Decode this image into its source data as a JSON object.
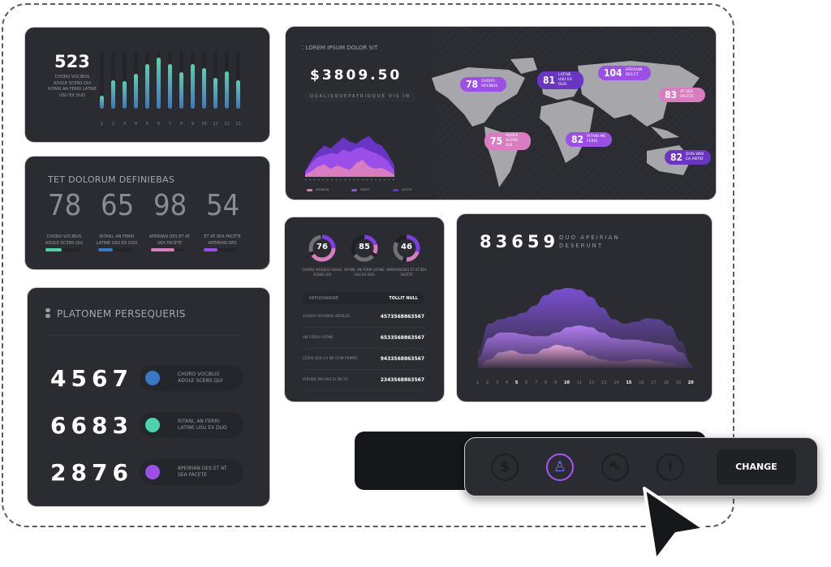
{
  "card_bars": {
    "value": "523",
    "caption": "CHORO VOCIBUS ADOLE SCENS QUI RITANI AN FERRI LATINE USU EX DUO",
    "labels": [
      "1",
      "2",
      "3",
      "4",
      "5",
      "6",
      "7",
      "8",
      "9",
      "10",
      "11",
      "12",
      "13"
    ],
    "values": [
      23,
      50,
      48,
      62,
      78,
      90,
      78,
      65,
      78,
      72,
      55,
      66,
      50
    ]
  },
  "card_stats": {
    "title": "TET DOLORUM DEFINIEBAS",
    "items": [
      {
        "value": "78",
        "caption": "CHORO VOCIBUS ADOLE SCENS QUI",
        "progress": 0.68,
        "color": "#4fd1b0"
      },
      {
        "value": "65",
        "caption": "RITANI, AN FERRI LATINE USU EX DUO",
        "progress": 0.62,
        "color": "#3b78c4"
      },
      {
        "value": "98",
        "caption": "APEIRIAN DES ET AT SEA FACETE",
        "progress": 0.98,
        "color": "#d97dc0"
      },
      {
        "value": "54",
        "caption": "ET AT SEA FACETE APEIRIAN DES",
        "progress": 0.58,
        "color": "#9b4fe8"
      }
    ]
  },
  "card_list": {
    "title": "PLATONEM PERSEQUERIS",
    "items": [
      {
        "value": "4567",
        "label": "CHORO VOCIBUS ADOLE SCENS QUI",
        "color": "#3b78c4"
      },
      {
        "value": "6683",
        "label": "RITANI, AN FERRI LATINE USU EX DUO",
        "color": "#4fd1b0"
      },
      {
        "value": "2876",
        "label": "APEIRIAN DES ET AT SEA FACETE",
        "color": "#9b4fe8"
      }
    ]
  },
  "card_map": {
    "title": "LOREM IPSUM DOLOR SIT",
    "amount": "$3809.50",
    "subtitle": "QUALISQUEPATRIDQUE VIS IN",
    "legend": [
      {
        "name": "APEIRIAN",
        "color": "#d97dc0"
      },
      {
        "name": "DESET",
        "color": "#9b4fe8"
      },
      {
        "name": "FACETE",
        "color": "#6a35c4"
      }
    ],
    "series": [
      [
        10,
        30,
        45,
        55,
        50,
        60,
        70,
        62,
        58,
        66,
        72,
        60,
        55,
        40,
        20
      ],
      [
        8,
        25,
        35,
        38,
        42,
        40,
        48,
        44,
        50,
        52,
        46,
        42,
        36,
        28,
        10
      ],
      [
        4,
        10,
        18,
        22,
        14,
        20,
        16,
        12,
        24,
        30,
        18,
        14,
        16,
        10,
        4
      ]
    ],
    "pins": [
      {
        "value": "78",
        "label": "CHORO VOCIBUS",
        "color": "#9b4fe8"
      },
      {
        "value": "81",
        "label": "LATINE USU EX DUO",
        "color": "#6a35c4"
      },
      {
        "value": "104",
        "label": "APEIRIAN DES ET",
        "color": "#9b4fe8"
      },
      {
        "value": "83",
        "label": "AT SEA FACETE",
        "color": "#d97dc0"
      },
      {
        "value": "75",
        "label": "ADOLE SCENS QUI",
        "color": "#d97dc0"
      },
      {
        "value": "82",
        "label": "RITANI AN FERRI",
        "color": "#9b4fe8"
      },
      {
        "value": "82",
        "label": "DUIS WISI EA ANTIO",
        "color": "#6a35c4"
      }
    ]
  },
  "card_donuts": {
    "donuts": [
      {
        "value": "76",
        "caption": "CHORO VOCIBUS ADOLE SCENS QUI",
        "segments": [
          0.25,
          0.4
        ]
      },
      {
        "value": "85",
        "caption": "RITANI, AN FERRI LATINE USU EX DUO",
        "segments": [
          0.2,
          0.12
        ]
      },
      {
        "value": "46",
        "caption": "APEIRIAN DES ET AT SEA FACETE",
        "segments": [
          0.3,
          0.2
        ]
      }
    ],
    "table": {
      "headers": [
        "REPUDIANDAE",
        "TOLLIT NULL"
      ],
      "rows": [
        [
          "CHORO VOCIBUS ADOLES",
          "4573568863567"
        ],
        [
          "AN FERRI LATINE",
          "6533568863567"
        ],
        [
          "CEDIS QUI CU NE CUM PRIMIS",
          "9433568863567"
        ],
        [
          "IRRURE AN HAS EI DICTA",
          "2343568863567"
        ]
      ]
    }
  },
  "card_waves": {
    "value": "83659",
    "caption": "DUO APEIRIAN DESERUNT",
    "x_labels": [
      "1",
      "2",
      "3",
      "4",
      "5",
      "6",
      "7",
      "8",
      "9",
      "10",
      "11",
      "12",
      "13",
      "14",
      "15",
      "16",
      "17",
      "18",
      "19",
      "20"
    ],
    "highlight": [
      "5",
      "10",
      "15",
      "20"
    ],
    "series": [
      [
        20,
        50,
        55,
        58,
        62,
        70,
        82,
        88,
        90,
        88,
        80,
        68,
        55,
        50,
        52,
        56,
        55,
        48,
        30,
        5
      ],
      [
        12,
        34,
        40,
        40,
        38,
        36,
        36,
        40,
        46,
        48,
        46,
        40,
        34,
        32,
        32,
        30,
        28,
        26,
        18,
        4
      ],
      [
        2,
        10,
        18,
        20,
        16,
        16,
        22,
        26,
        24,
        20,
        14,
        10,
        8,
        8,
        10,
        10,
        8,
        6,
        3,
        0
      ]
    ]
  },
  "toolbar": {
    "icons": [
      "dollar-icon",
      "user-icon",
      "cart-icon",
      "info-icon"
    ],
    "active": "user-icon",
    "button": "CHANGE"
  }
}
